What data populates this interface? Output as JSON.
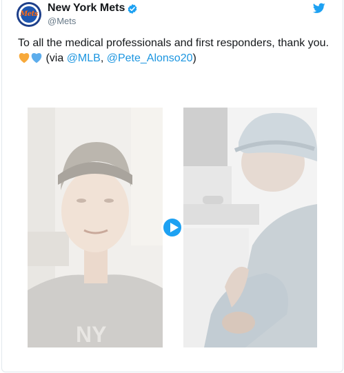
{
  "tweet": {
    "author_name": "New York Mets",
    "author_handle": "@Mets",
    "avatar_text": "Mets",
    "text_main": "To all the medical professionals and first responders, thank you.",
    "via_prefix": "(via ",
    "mention_1": "@MLB",
    "separator": ", ",
    "mention_2": "@Pete_Alonso20",
    "via_suffix": ")",
    "emoji": [
      "orange-heart-icon",
      "blue-heart-icon"
    ]
  },
  "colors": {
    "link": "#1b95e0",
    "twitter_blue": "#1da1f2",
    "orange_heart": "#f7a93b",
    "blue_heart": "#5dadec"
  },
  "media": {
    "type": "video",
    "play_icon": "play-icon"
  }
}
